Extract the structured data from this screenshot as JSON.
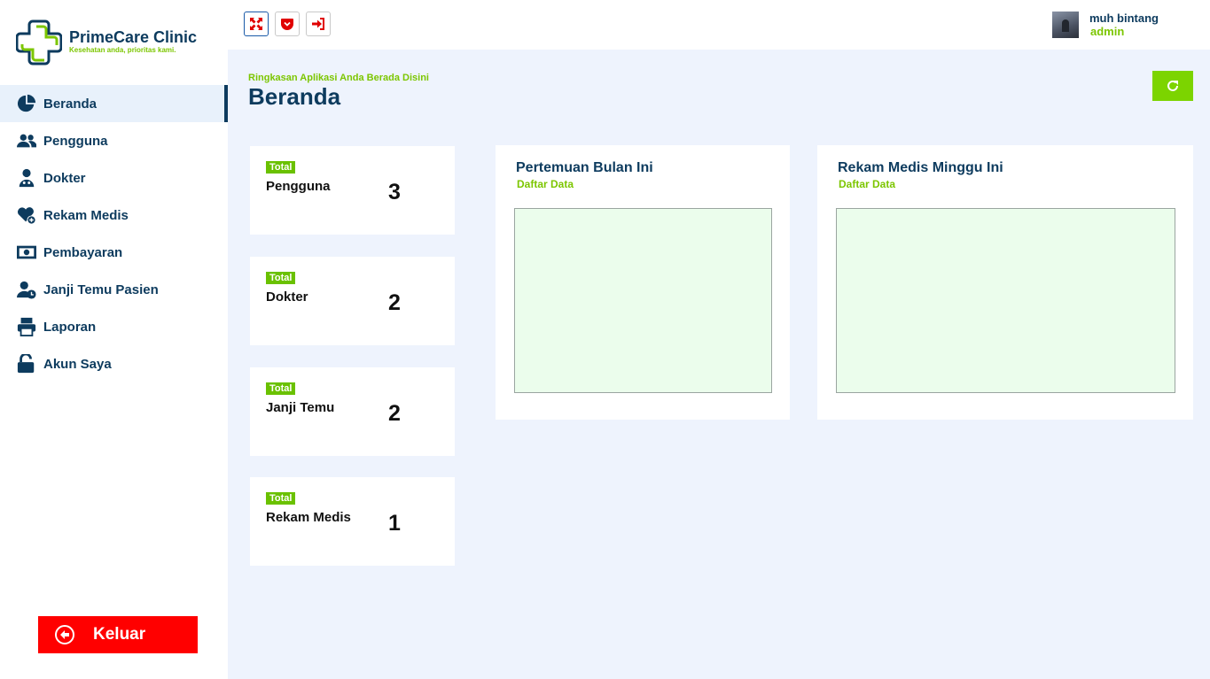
{
  "brand": {
    "name": "PrimeCare Clinic",
    "tagline": "Kesehatan anda, prioritas kami.",
    "primary_color": "#0d3b5e",
    "accent_color": "#7cc600"
  },
  "sidebar": {
    "items": [
      {
        "label": "Beranda",
        "icon": "pie-chart-icon",
        "active": true
      },
      {
        "label": "Pengguna",
        "icon": "users-icon"
      },
      {
        "label": "Dokter",
        "icon": "doctor-icon"
      },
      {
        "label": "Rekam Medis",
        "icon": "heart-plus-icon"
      },
      {
        "label": "Pembayaran",
        "icon": "money-bill-icon"
      },
      {
        "label": "Janji Temu Pasien",
        "icon": "user-clock-icon"
      },
      {
        "label": "Laporan",
        "icon": "printer-icon"
      },
      {
        "label": "Akun Saya",
        "icon": "unlock-icon"
      }
    ],
    "logout_label": "Keluar"
  },
  "topbar": {
    "buttons": [
      "fullscreen-icon",
      "pocket-icon",
      "sign-in-icon"
    ],
    "user_name": "muh bintang",
    "user_role": "admin"
  },
  "page": {
    "hint": "Ringkasan Aplikasi Anda Berada Disini",
    "title": "Beranda"
  },
  "stats": [
    {
      "badge": "Total",
      "label": "Pengguna",
      "value": "3"
    },
    {
      "badge": "Total",
      "label": "Dokter",
      "value": "2"
    },
    {
      "badge": "Total",
      "label": "Janji Temu",
      "value": "2"
    },
    {
      "badge": "Total",
      "label": "Rekam Medis",
      "value": "1"
    }
  ],
  "panels": [
    {
      "title": "Pertemuan Bulan Ini",
      "subtitle": "Daftar Data"
    },
    {
      "title": "Rekam Medis Minggu Ini",
      "subtitle": "Daftar Data"
    }
  ]
}
